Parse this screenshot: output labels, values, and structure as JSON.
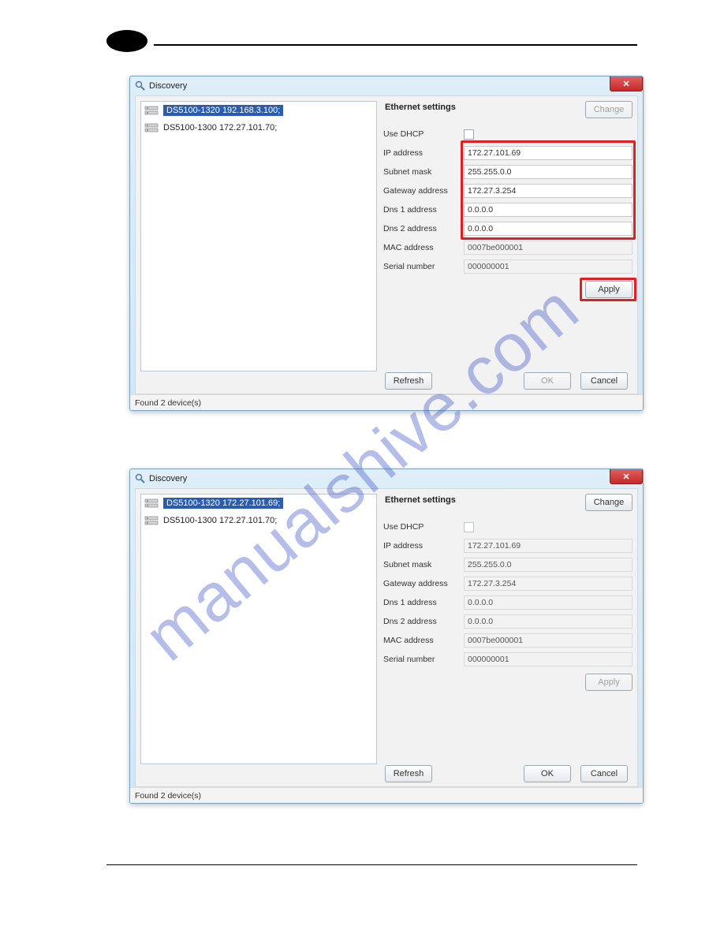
{
  "watermark": "manualshive.com",
  "window1": {
    "title": "Discovery",
    "devices": [
      {
        "label": "DS5100-1320 192.168.3.100;",
        "selected": true
      },
      {
        "label": "DS5100-1300 172.27.101.70;",
        "selected": false
      }
    ],
    "panelTitle": "Ethernet settings",
    "changeLabel": "Change",
    "changeDisabled": true,
    "fields": {
      "dhcpLabel": "Use DHCP",
      "ipLabel": "IP address",
      "ipValue": "172.27.101.69",
      "subnetLabel": "Subnet mask",
      "subnetValue": "255.255.0.0",
      "gatewayLabel": "Gateway address",
      "gatewayValue": "172.27.3.254",
      "dns1Label": "Dns 1 address",
      "dns1Value": "0.0.0.0",
      "dns2Label": "Dns 2 address",
      "dns2Value": "0.0.0.0",
      "macLabel": "MAC address",
      "macValue": "0007be000001",
      "serialLabel": "Serial number",
      "serialValue": "000000001"
    },
    "applyLabel": "Apply",
    "applyDisabled": false,
    "refreshLabel": "Refresh",
    "okLabel": "OK",
    "okDisabled": true,
    "cancelLabel": "Cancel",
    "status": "Found 2 device(s)"
  },
  "window2": {
    "title": "Discovery",
    "devices": [
      {
        "label": "DS5100-1320 172.27.101.69;",
        "selected": true
      },
      {
        "label": "DS5100-1300 172.27.101.70;",
        "selected": false
      }
    ],
    "panelTitle": "Ethernet settings",
    "changeLabel": "Change",
    "changeDisabled": false,
    "fields": {
      "dhcpLabel": "Use DHCP",
      "ipLabel": "IP address",
      "ipValue": "172.27.101.69",
      "subnetLabel": "Subnet mask",
      "subnetValue": "255.255.0.0",
      "gatewayLabel": "Gateway address",
      "gatewayValue": "172.27.3.254",
      "dns1Label": "Dns 1 address",
      "dns1Value": "0.0.0.0",
      "dns2Label": "Dns 2 address",
      "dns2Value": "0.0.0.0",
      "macLabel": "MAC address",
      "macValue": "0007be000001",
      "serialLabel": "Serial number",
      "serialValue": "000000001"
    },
    "applyLabel": "Apply",
    "applyDisabled": true,
    "refreshLabel": "Refresh",
    "okLabel": "OK",
    "okDisabled": false,
    "cancelLabel": "Cancel",
    "status": "Found 2 device(s)"
  }
}
